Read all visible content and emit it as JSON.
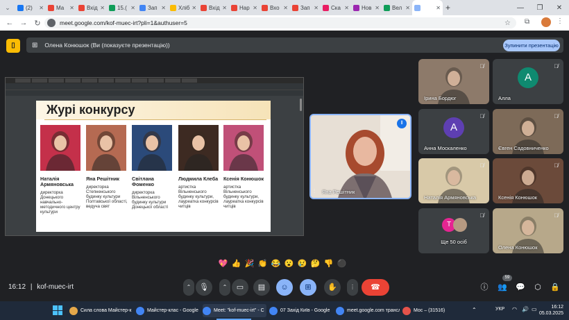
{
  "browser": {
    "tabs": [
      {
        "label": "(2)",
        "color": "#1877f2"
      },
      {
        "label": "Ма",
        "color": "#ea4335"
      },
      {
        "label": "Вхід",
        "color": "#ea4335"
      },
      {
        "label": "15.(",
        "color": "#0f9d58"
      },
      {
        "label": "Зап",
        "color": "#4285f4"
      },
      {
        "label": "Хліб",
        "color": "#fbbc04"
      },
      {
        "label": "Вхід",
        "color": "#ea4335"
      },
      {
        "label": "Нар",
        "color": "#ea4335"
      },
      {
        "label": "Вхо",
        "color": "#ea4335"
      },
      {
        "label": "Зап",
        "color": "#ea4335"
      },
      {
        "label": "Ска",
        "color": "#e91e63"
      },
      {
        "label": "Нов",
        "color": "#9c27b0"
      },
      {
        "label": "Вел",
        "color": "#0f9d58"
      },
      {
        "label": "",
        "color": "#8ab4f8"
      }
    ],
    "new_tab": "+",
    "url": "meet.google.com/kof-muec-irt?pli=1&authuser=5"
  },
  "meet": {
    "presenting_label": "Олена Конюшок (Ви (показуєте презентацію))",
    "stop_presenting": "Зупинити презентацію",
    "slide": {
      "title": "Журі конкурсу",
      "jury": [
        {
          "name": "Наталія Армяновська",
          "desc": "директорка Донецького навчально-методичного центру культури",
          "color": "#c4304a"
        },
        {
          "name": "Яна Решітник",
          "desc": "директорка Степненського будинку культури Полтавської області, ведуча свят",
          "color": "#b56a52"
        },
        {
          "name": "Світлана Фоменко",
          "desc": "директорка Вільненського будинку культури Донецької області",
          "color": "#2b4a7a"
        },
        {
          "name": "Людмила Клеба",
          "desc": "артистка Вільненського будинку культури, лауреатка конкурсів читців",
          "color": "#3d2a22"
        },
        {
          "name": "Ксенія Конюшок",
          "desc": "артистка Вільненського будинку культури, лауреатка конкурсів читців",
          "color": "#c05078"
        }
      ]
    },
    "main_speaker": "Яна Решітник",
    "tiles": [
      {
        "name": "Ірина Бордюг",
        "kind": "photo",
        "color": "#8d7a6a"
      },
      {
        "name": "Алла",
        "kind": "avatar",
        "initial": "A",
        "color": "#0f8a70"
      },
      {
        "name": "Анна Москаленко",
        "kind": "avatar",
        "initial": "A",
        "color": "#5e3fb2"
      },
      {
        "name": "Євген Садовниченко",
        "kind": "photo",
        "color": "#7d6a58"
      },
      {
        "name": "Наталія Армяновська",
        "kind": "photo",
        "color": "#d8c9a8"
      },
      {
        "name": "Ксенія Конюшок",
        "kind": "photo",
        "color": "#6b4a3a"
      },
      {
        "name": "Ще 50 осіб",
        "kind": "more",
        "initial": "T",
        "color": "#e52592"
      },
      {
        "name": "Олена Конюшок",
        "kind": "photo",
        "color": "#b7a88a"
      }
    ],
    "reactions": [
      "💖",
      "👍",
      "🎉",
      "👏",
      "😂",
      "😮",
      "😢",
      "🤔",
      "👎",
      "⚫"
    ],
    "time": "16:12",
    "meeting_code": "kof-muec-irt",
    "people_count": "59"
  },
  "taskbar": {
    "items": [
      "Сила слова Майстер-к",
      "Майстер-клас - Google",
      "Meet: \"kof-muec-irt\" - C",
      "07 Захід Київ - Google",
      "meet.google.com трансл",
      "Мос – (31516)"
    ],
    "lang": "УКР",
    "clock_time": "16:12",
    "clock_date": "05.03.2025"
  }
}
